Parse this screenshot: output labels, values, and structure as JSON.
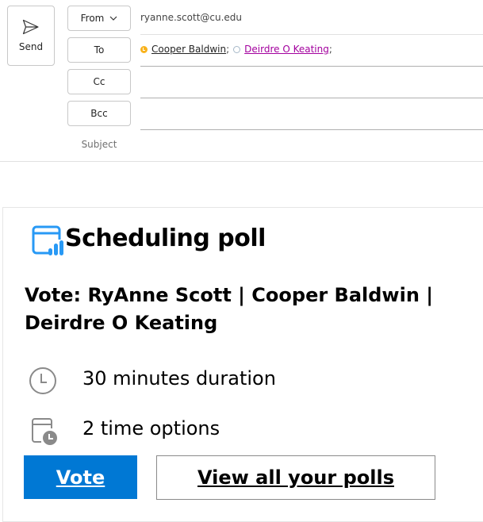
{
  "compose": {
    "send_label": "Send",
    "from_label": "From",
    "from_value": "ryanne.scott@cu.edu",
    "to_label": "To",
    "cc_label": "Cc",
    "bcc_label": "Bcc",
    "subject_label": "Subject",
    "recipients": [
      {
        "name": "Cooper Baldwin",
        "separator": ";",
        "presence": "away",
        "presence_color": "#f8b21c",
        "link_color": "#242424"
      },
      {
        "name": "Deirdre O Keating",
        "separator": ";",
        "presence": "offline",
        "presence_color": "#a6b8c8",
        "link_color": "#a3009e"
      }
    ]
  },
  "card": {
    "title": "Scheduling poll",
    "icon": "calendar-poll-icon",
    "accent_color": "#2899f5",
    "vote_title": "Vote: RyAnne Scott | Cooper Baldwin | Deirdre O Keating",
    "duration": "30 minutes duration",
    "options": "2 time options",
    "vote_label": "Vote",
    "view_label": "View all your polls",
    "vote_color": "#0078d4"
  }
}
